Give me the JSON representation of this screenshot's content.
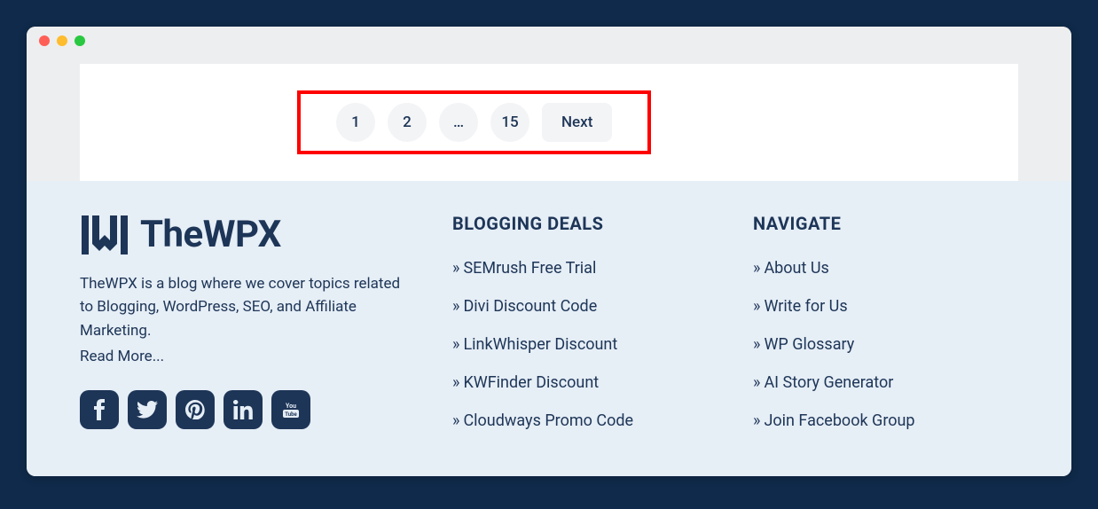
{
  "pagination": {
    "pages": [
      "1",
      "2",
      "…",
      "15"
    ],
    "next": "Next"
  },
  "footer": {
    "brand": {
      "name": "TheWPX",
      "description": "TheWPX is a blog where we cover topics related to Blogging, WordPress, SEO, and Affiliate Marketing.",
      "read_more": "Read More..."
    },
    "social": {
      "facebook": "facebook-icon",
      "twitter": "twitter-icon",
      "pinterest": "pinterest-icon",
      "linkedin": "linkedin-icon",
      "youtube": "youtube-icon"
    },
    "columns": [
      {
        "heading": "BLOGGING DEALS",
        "items": [
          "SEMrush Free Trial",
          "Divi Discount Code",
          "LinkWhisper Discount",
          "KWFinder Discount",
          "Cloudways Promo Code"
        ]
      },
      {
        "heading": "NAVIGATE",
        "items": [
          "About Us",
          "Write for Us",
          "WP Glossary",
          "AI Story Generator",
          "Join Facebook Group"
        ]
      }
    ]
  }
}
